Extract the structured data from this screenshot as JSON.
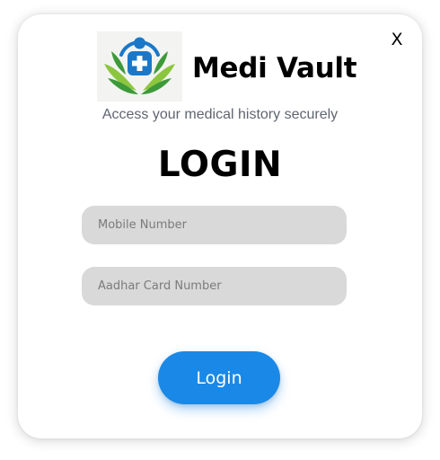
{
  "modal": {
    "close_label": "X",
    "app_name": "Medi Vault",
    "tagline": "Access your medical history securely",
    "title": "LOGIN"
  },
  "form": {
    "mobile_placeholder": "Mobile Number",
    "aadhar_placeholder": "Aadhar Card Number",
    "login_label": "Login"
  },
  "logo": {
    "icon": "medical-cross-leaves-icon",
    "colors": {
      "accent_blue": "#1b78c9",
      "leaf_green": "#3d9a3a",
      "leaf_light": "#8cc63f"
    }
  },
  "theme": {
    "button_color": "#1a88e6",
    "field_color": "#d9d9d9"
  }
}
